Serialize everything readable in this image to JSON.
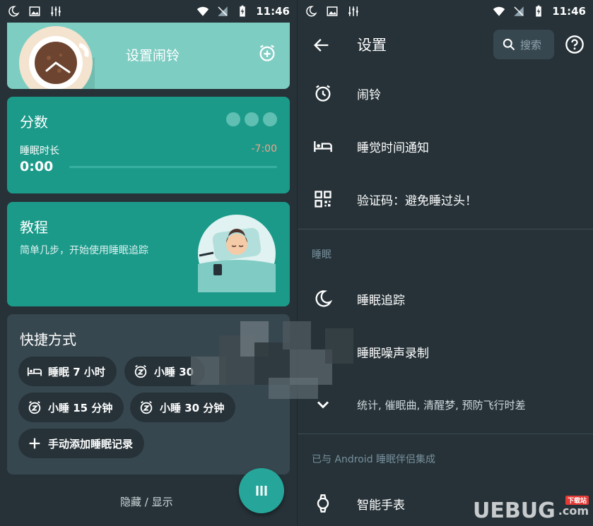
{
  "status": {
    "time": "11:46"
  },
  "left": {
    "alarm_card": {
      "title": "设置闹铃"
    },
    "score_card": {
      "title": "分数",
      "sleep_label": "睡眠时长",
      "sleep_value": "0:00",
      "sleep_delta": "-7:00"
    },
    "tutorial_card": {
      "title": "教程",
      "description": "简单几步，开始使用睡眠追踪"
    },
    "shortcuts_card": {
      "title": "快捷方式",
      "chips": [
        {
          "label": "睡眠 7 小时",
          "icon": "bed-icon"
        },
        {
          "label": "小睡 30",
          "icon": "snooze-icon"
        },
        {
          "label": "小睡 15 分钟",
          "icon": "snooze-icon"
        },
        {
          "label": "小睡 30 分钟",
          "icon": "snooze-icon"
        },
        {
          "label": "手动添加睡眠记录",
          "icon": "plus-icon"
        }
      ]
    },
    "toggle_label": "隐藏 / 显示"
  },
  "right": {
    "appbar": {
      "title": "设置",
      "search_placeholder": "搜索"
    },
    "items": [
      {
        "label": "闹铃",
        "icon": "alarm-icon"
      },
      {
        "label": "睡觉时间通知",
        "icon": "bed-icon"
      },
      {
        "label": "验证码：避免睡过头！",
        "icon": "qr-code-icon"
      }
    ],
    "section_sleep": "睡眠",
    "sleep_items": [
      {
        "label": "睡眠追踪",
        "icon": "moon-icon"
      },
      {
        "label": "睡眠噪声录制",
        "icon": ""
      },
      {
        "label": "统计, 催眠曲, 清醒梦, 预防飞行时差",
        "icon": "chevron-down-icon"
      }
    ],
    "section_android": "已与 Android 睡眠伴侣集成",
    "android_items": [
      {
        "label": "智能手表",
        "icon": "watch-icon"
      }
    ]
  },
  "watermark": {
    "brand": "UEBUG",
    "domain": ".com",
    "tag": "下载站"
  },
  "colors": {
    "teal": "#1b9a8a",
    "mint": "#7ecdc3",
    "dark": "#263238",
    "card_gray": "#37474f",
    "fab": "#26a69a"
  }
}
